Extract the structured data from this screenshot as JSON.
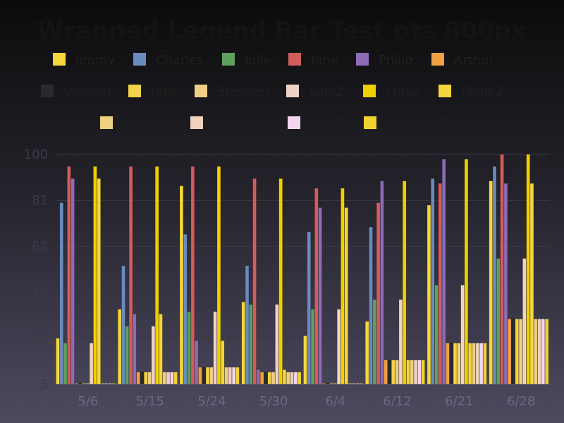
{
  "chart_data": {
    "type": "bar",
    "title": "Wrapped Legend Bar Test pts 800px",
    "xlabel": "",
    "ylabel": "",
    "ylim": [
      5,
      100
    ],
    "yticks": [
      5,
      24,
      43,
      62,
      81,
      100
    ],
    "grid": true,
    "legend_position": "top",
    "categories": [
      "5/6",
      "5/15",
      "5/24",
      "5/30",
      "6/4",
      "6/12",
      "6/21",
      "6/28"
    ],
    "series": [
      {
        "name": "Jimmy",
        "color": "#f5d73b",
        "values": [
          24,
          36,
          87,
          39,
          25,
          31,
          79,
          89
        ]
      },
      {
        "name": "Charles",
        "color": "#6b8bbf",
        "values": [
          80,
          54,
          67,
          54,
          68,
          70,
          90,
          95
        ]
      },
      {
        "name": "Julie",
        "color": "#5fa05f",
        "values": [
          22,
          29,
          35,
          38,
          36,
          40,
          46,
          57
        ]
      },
      {
        "name": "Jane",
        "color": "#d25d5d",
        "values": [
          95,
          95,
          95,
          90,
          86,
          80,
          88,
          100
        ]
      },
      {
        "name": "Philip",
        "color": "#8d6bb5",
        "values": [
          90,
          34,
          23,
          11,
          78,
          89,
          98,
          88
        ]
      },
      {
        "name": "Arthur",
        "color": "#f0a040",
        "values": [
          5,
          10,
          12,
          10,
          5,
          15,
          22,
          32
        ]
      },
      {
        "name": "Vincent",
        "color": "#2a2a2a",
        "values": [
          5,
          10,
          12,
          10,
          5,
          15,
          22,
          32
        ]
      },
      {
        "name": "Jake",
        "color": "#f2d24a",
        "values": [
          5,
          10,
          12,
          10,
          5,
          15,
          22,
          32
        ]
      },
      {
        "name": "Stephen",
        "color": "#efcf85",
        "values": [
          5,
          10,
          12,
          10,
          5,
          15,
          22,
          32
        ]
      },
      {
        "name": "Julie2",
        "color": "#efd3c6",
        "values": [
          22,
          29,
          35,
          38,
          36,
          40,
          46,
          57
        ]
      },
      {
        "name": "Jane2",
        "color": "#f0d000",
        "values": [
          95,
          95,
          95,
          90,
          86,
          89,
          98,
          100
        ]
      },
      {
        "name": "Philip2",
        "color": "#f2d63c",
        "values": [
          90,
          34,
          23,
          11,
          78,
          15,
          22,
          88
        ]
      },
      {
        "name": "Arthur2",
        "color": "#efd080",
        "values": [
          5,
          10,
          12,
          10,
          5,
          15,
          22,
          32
        ]
      },
      {
        "name": "Vincent2",
        "color": "#f0d2bd",
        "values": [
          5,
          10,
          12,
          10,
          5,
          15,
          22,
          32
        ]
      },
      {
        "name": "Jake2",
        "color": "#f3d6f2",
        "values": [
          5,
          10,
          12,
          10,
          5,
          15,
          22,
          32
        ]
      },
      {
        "name": "Stephen2",
        "color": "#f0d230",
        "values": [
          5,
          10,
          12,
          10,
          5,
          15,
          22,
          32
        ]
      }
    ]
  }
}
